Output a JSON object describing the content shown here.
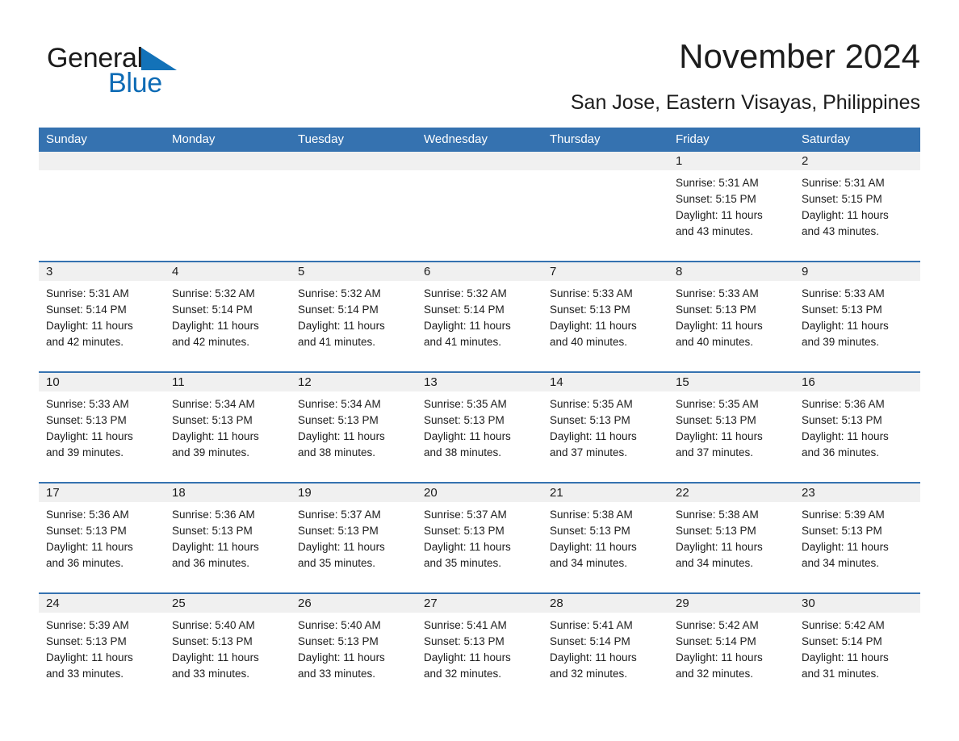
{
  "brand": {
    "name_part1": "General",
    "name_part2": "Blue",
    "accent_color": "#0d6bb5",
    "triangle_color": "#1372b8"
  },
  "header": {
    "title": "November 2024",
    "subtitle": "San Jose, Eastern Visayas, Philippines"
  },
  "theme": {
    "header_row_bg": "#3572b0",
    "date_band_bg": "#f0f0f0",
    "week_rule": "#3572b0"
  },
  "weekday_headers": [
    "Sunday",
    "Monday",
    "Tuesday",
    "Wednesday",
    "Thursday",
    "Friday",
    "Saturday"
  ],
  "weeks": [
    {
      "days": [
        {
          "num": "",
          "lines": []
        },
        {
          "num": "",
          "lines": []
        },
        {
          "num": "",
          "lines": []
        },
        {
          "num": "",
          "lines": []
        },
        {
          "num": "",
          "lines": []
        },
        {
          "num": "1",
          "lines": [
            "Sunrise: 5:31 AM",
            "Sunset: 5:15 PM",
            "Daylight: 11 hours",
            "and 43 minutes."
          ]
        },
        {
          "num": "2",
          "lines": [
            "Sunrise: 5:31 AM",
            "Sunset: 5:15 PM",
            "Daylight: 11 hours",
            "and 43 minutes."
          ]
        }
      ]
    },
    {
      "days": [
        {
          "num": "3",
          "lines": [
            "Sunrise: 5:31 AM",
            "Sunset: 5:14 PM",
            "Daylight: 11 hours",
            "and 42 minutes."
          ]
        },
        {
          "num": "4",
          "lines": [
            "Sunrise: 5:32 AM",
            "Sunset: 5:14 PM",
            "Daylight: 11 hours",
            "and 42 minutes."
          ]
        },
        {
          "num": "5",
          "lines": [
            "Sunrise: 5:32 AM",
            "Sunset: 5:14 PM",
            "Daylight: 11 hours",
            "and 41 minutes."
          ]
        },
        {
          "num": "6",
          "lines": [
            "Sunrise: 5:32 AM",
            "Sunset: 5:14 PM",
            "Daylight: 11 hours",
            "and 41 minutes."
          ]
        },
        {
          "num": "7",
          "lines": [
            "Sunrise: 5:33 AM",
            "Sunset: 5:13 PM",
            "Daylight: 11 hours",
            "and 40 minutes."
          ]
        },
        {
          "num": "8",
          "lines": [
            "Sunrise: 5:33 AM",
            "Sunset: 5:13 PM",
            "Daylight: 11 hours",
            "and 40 minutes."
          ]
        },
        {
          "num": "9",
          "lines": [
            "Sunrise: 5:33 AM",
            "Sunset: 5:13 PM",
            "Daylight: 11 hours",
            "and 39 minutes."
          ]
        }
      ]
    },
    {
      "days": [
        {
          "num": "10",
          "lines": [
            "Sunrise: 5:33 AM",
            "Sunset: 5:13 PM",
            "Daylight: 11 hours",
            "and 39 minutes."
          ]
        },
        {
          "num": "11",
          "lines": [
            "Sunrise: 5:34 AM",
            "Sunset: 5:13 PM",
            "Daylight: 11 hours",
            "and 39 minutes."
          ]
        },
        {
          "num": "12",
          "lines": [
            "Sunrise: 5:34 AM",
            "Sunset: 5:13 PM",
            "Daylight: 11 hours",
            "and 38 minutes."
          ]
        },
        {
          "num": "13",
          "lines": [
            "Sunrise: 5:35 AM",
            "Sunset: 5:13 PM",
            "Daylight: 11 hours",
            "and 38 minutes."
          ]
        },
        {
          "num": "14",
          "lines": [
            "Sunrise: 5:35 AM",
            "Sunset: 5:13 PM",
            "Daylight: 11 hours",
            "and 37 minutes."
          ]
        },
        {
          "num": "15",
          "lines": [
            "Sunrise: 5:35 AM",
            "Sunset: 5:13 PM",
            "Daylight: 11 hours",
            "and 37 minutes."
          ]
        },
        {
          "num": "16",
          "lines": [
            "Sunrise: 5:36 AM",
            "Sunset: 5:13 PM",
            "Daylight: 11 hours",
            "and 36 minutes."
          ]
        }
      ]
    },
    {
      "days": [
        {
          "num": "17",
          "lines": [
            "Sunrise: 5:36 AM",
            "Sunset: 5:13 PM",
            "Daylight: 11 hours",
            "and 36 minutes."
          ]
        },
        {
          "num": "18",
          "lines": [
            "Sunrise: 5:36 AM",
            "Sunset: 5:13 PM",
            "Daylight: 11 hours",
            "and 36 minutes."
          ]
        },
        {
          "num": "19",
          "lines": [
            "Sunrise: 5:37 AM",
            "Sunset: 5:13 PM",
            "Daylight: 11 hours",
            "and 35 minutes."
          ]
        },
        {
          "num": "20",
          "lines": [
            "Sunrise: 5:37 AM",
            "Sunset: 5:13 PM",
            "Daylight: 11 hours",
            "and 35 minutes."
          ]
        },
        {
          "num": "21",
          "lines": [
            "Sunrise: 5:38 AM",
            "Sunset: 5:13 PM",
            "Daylight: 11 hours",
            "and 34 minutes."
          ]
        },
        {
          "num": "22",
          "lines": [
            "Sunrise: 5:38 AM",
            "Sunset: 5:13 PM",
            "Daylight: 11 hours",
            "and 34 minutes."
          ]
        },
        {
          "num": "23",
          "lines": [
            "Sunrise: 5:39 AM",
            "Sunset: 5:13 PM",
            "Daylight: 11 hours",
            "and 34 minutes."
          ]
        }
      ]
    },
    {
      "days": [
        {
          "num": "24",
          "lines": [
            "Sunrise: 5:39 AM",
            "Sunset: 5:13 PM",
            "Daylight: 11 hours",
            "and 33 minutes."
          ]
        },
        {
          "num": "25",
          "lines": [
            "Sunrise: 5:40 AM",
            "Sunset: 5:13 PM",
            "Daylight: 11 hours",
            "and 33 minutes."
          ]
        },
        {
          "num": "26",
          "lines": [
            "Sunrise: 5:40 AM",
            "Sunset: 5:13 PM",
            "Daylight: 11 hours",
            "and 33 minutes."
          ]
        },
        {
          "num": "27",
          "lines": [
            "Sunrise: 5:41 AM",
            "Sunset: 5:13 PM",
            "Daylight: 11 hours",
            "and 32 minutes."
          ]
        },
        {
          "num": "28",
          "lines": [
            "Sunrise: 5:41 AM",
            "Sunset: 5:14 PM",
            "Daylight: 11 hours",
            "and 32 minutes."
          ]
        },
        {
          "num": "29",
          "lines": [
            "Sunrise: 5:42 AM",
            "Sunset: 5:14 PM",
            "Daylight: 11 hours",
            "and 32 minutes."
          ]
        },
        {
          "num": "30",
          "lines": [
            "Sunrise: 5:42 AM",
            "Sunset: 5:14 PM",
            "Daylight: 11 hours",
            "and 31 minutes."
          ]
        }
      ]
    }
  ]
}
